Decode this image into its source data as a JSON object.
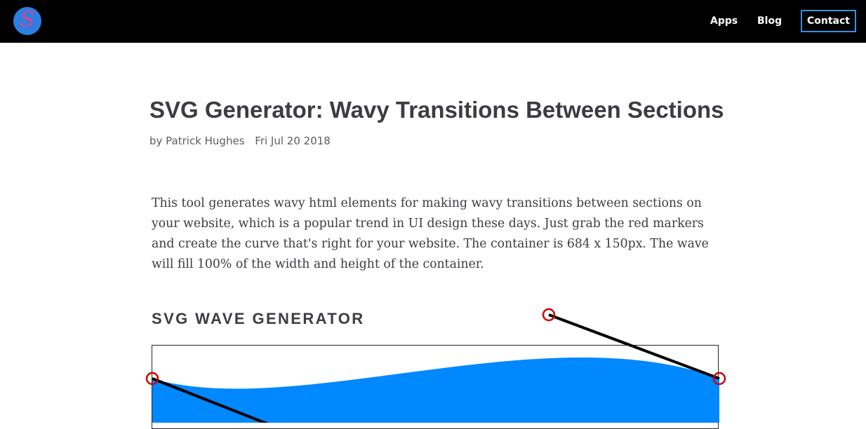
{
  "nav": {
    "logo_glyph": "S",
    "links": [
      "Apps",
      "Blog"
    ],
    "contact": "Contact"
  },
  "article": {
    "title": "SVG Generator: Wavy Transitions Between Sections",
    "author": "by Patrick Hughes",
    "date": "Fri Jul 20 2018",
    "intro": "This tool generates wavy html elements for making wavy transitions between sections on your website, which is a popular trend in UI design these days. Just grab the red markers and create the curve that's right for your website. The container is 684 x 150px. The wave will fill 100% of the width and height of the container."
  },
  "generator": {
    "heading": "SVG WAVE GENERATOR",
    "wave_color": "#0088ff",
    "marker_color": "#d00000",
    "handle_line_color": "#000000"
  }
}
